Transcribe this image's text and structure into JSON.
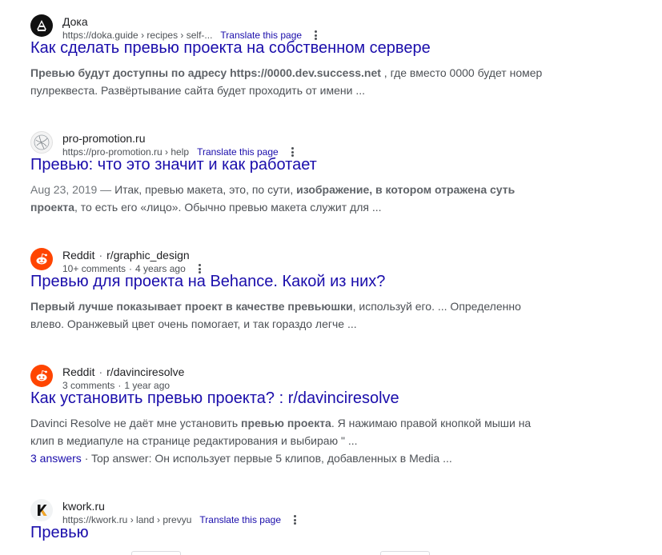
{
  "results": [
    {
      "site": "Дока",
      "breadcrumb": "https://doka.guide › recipes › self-...",
      "translate": "Translate this page",
      "title": "Как сделать превью проекта на собственном сервере",
      "snippet": [
        {
          "t": "Превью будут доступны по адресу https://0000.dev.success.net",
          "b": true
        },
        {
          "t": " , где вместо 0000 будет номер пулреквеста. Развёртывание сайта будет проходить от имени ...",
          "b": false
        }
      ],
      "icon": "doka-logo-icon"
    },
    {
      "site": "pro-promotion.ru",
      "breadcrumb": "https://pro-promotion.ru › help",
      "translate": "Translate this page",
      "title": "Превью: что это значит и как работает",
      "date": "Aug 23, 2019 — ",
      "snippet": [
        {
          "t": "Итак, превью макета, это, по сути, ",
          "b": false
        },
        {
          "t": "изображение, в котором отражена суть проекта",
          "b": true
        },
        {
          "t": ", то есть его «лицо». Обычно превью макета служит для ...",
          "b": false
        }
      ],
      "icon": "pro-promotion-logo-icon"
    },
    {
      "site": "Reddit",
      "subsite": "r/graphic_design",
      "meta1": "10+ comments",
      "meta2": "4 years ago",
      "title": "Превью для проекта на Behance. Какой из них?",
      "snippet": [
        {
          "t": "Первый лучше показывает проект в качестве превьюшки",
          "b": true
        },
        {
          "t": ", используй его. ... Определенно влево. Оранжевый цвет очень помогает, и так гораздо легче ...",
          "b": false
        }
      ],
      "icon": "reddit-logo-icon"
    },
    {
      "site": "Reddit",
      "subsite": "r/davinciresolve",
      "meta1": "3 comments",
      "meta2": "1 year ago",
      "title": "Как установить превью проекта? : r/davinciresolve",
      "snippet": [
        {
          "t": "Davinci Resolve не даёт мне установить ",
          "b": false
        },
        {
          "t": "превью проекта",
          "b": true
        },
        {
          "t": ". Я нажимаю правой кнопкой мыши на клип в медиапуле на странице редактирования и выбираю \" ...",
          "b": false
        }
      ],
      "answers": "3 answers",
      "top_answer": " · Top answer: Он использует первые 5 клипов, добавленных в Media ...",
      "icon": "reddit-logo-icon"
    },
    {
      "site": "kwork.ru",
      "breadcrumb": "https://kwork.ru › land › prevyu",
      "translate": "Translate this page",
      "title": "Превью",
      "icon": "kwork-logo-icon"
    }
  ],
  "colors": {
    "link": "#1a0dab",
    "text": "#202124",
    "snippet": "#4d5156",
    "reddit": "#ff4500"
  }
}
